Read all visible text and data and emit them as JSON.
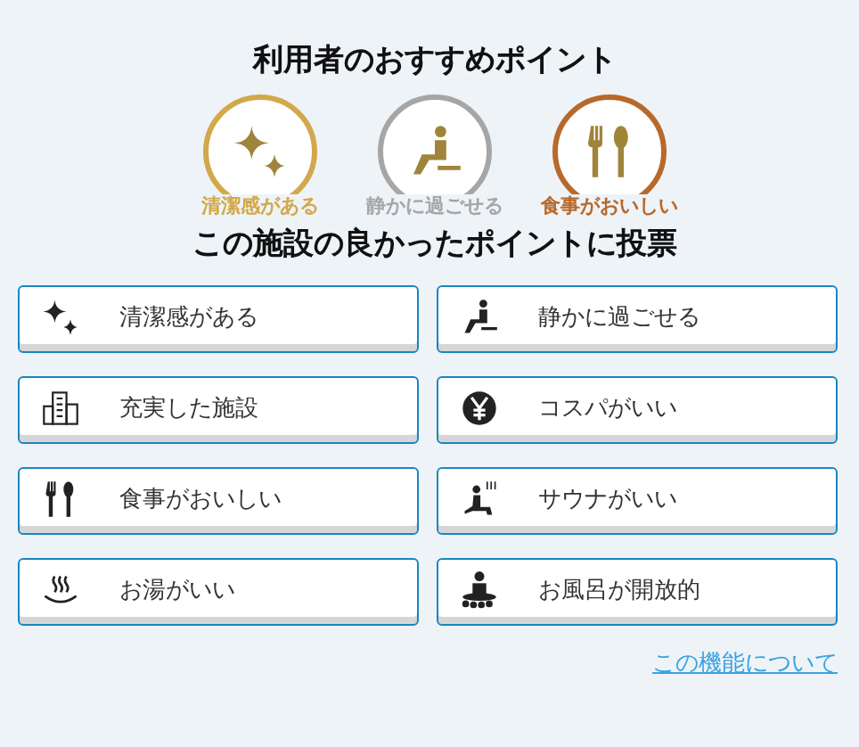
{
  "title": "利用者のおすすめポイント",
  "badges": [
    {
      "kind": "sparkle",
      "label": "清潔感がある",
      "color": "#d2a94a"
    },
    {
      "kind": "relax",
      "label": "静かに過ごせる",
      "color": "#a6a6a6"
    },
    {
      "kind": "food",
      "label": "食事がおいしい",
      "color": "#b8692a"
    }
  ],
  "vote_heading": "この施設の良かったポイントに投票",
  "options": [
    {
      "kind": "sparkle",
      "label": "清潔感がある"
    },
    {
      "kind": "relax",
      "label": "静かに過ごせる"
    },
    {
      "kind": "building",
      "label": "充実した施設"
    },
    {
      "kind": "yen",
      "label": "コスパがいい"
    },
    {
      "kind": "food",
      "label": "食事がおいしい"
    },
    {
      "kind": "sauna",
      "label": "サウナがいい"
    },
    {
      "kind": "bath",
      "label": "お湯がいい"
    },
    {
      "kind": "openbath",
      "label": "お風呂が開放的"
    }
  ],
  "about_link": "この機能について"
}
